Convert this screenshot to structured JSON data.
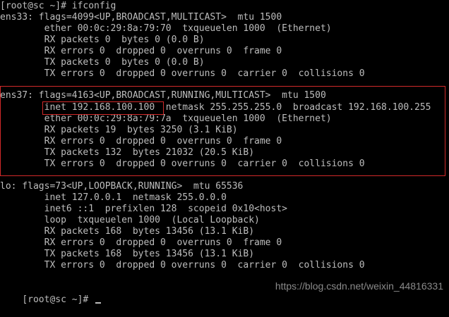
{
  "terminal": {
    "lines": [
      "[root@sc ~]# ifconfig",
      "ens33: flags=4099<UP,BROADCAST,MULTICAST>  mtu 1500",
      "        ether 00:0c:29:8a:79:70  txqueuelen 1000  (Ethernet)",
      "        RX packets 0  bytes 0 (0.0 B)",
      "        RX errors 0  dropped 0  overruns 0  frame 0",
      "        TX packets 0  bytes 0 (0.0 B)",
      "        TX errors 0  dropped 0 overruns 0  carrier 0  collisions 0",
      "",
      "ens37: flags=4163<UP,BROADCAST,RUNNING,MULTICAST>  mtu 1500",
      "        inet 192.168.100.100  netmask 255.255.255.0  broadcast 192.168.100.255",
      "        ether 00:0c:29:8a:79:7a  txqueuelen 1000  (Ethernet)",
      "        RX packets 19  bytes 3250 (3.1 KiB)",
      "        RX errors 0  dropped 0  overruns 0  frame 0",
      "        TX packets 132  bytes 21032 (20.5 KiB)",
      "        TX errors 0  dropped 0 overruns 0  carrier 0  collisions 0",
      "",
      "lo: flags=73<UP,LOOPBACK,RUNNING>  mtu 65536",
      "        inet 127.0.0.1  netmask 255.0.0.0",
      "        inet6 ::1  prefixlen 128  scopeid 0x10<host>",
      "        loop  txqueuelen 1000  (Local Loopback)",
      "        RX packets 168  bytes 13456 (13.1 KiB)",
      "        RX errors 0  dropped 0  overruns 0  frame 0",
      "        TX packets 168  bytes 13456 (13.1 KiB)",
      "        TX errors 0  dropped 0 overruns 0  carrier 0  collisions 0",
      "",
      "[root@sc ~]# "
    ]
  },
  "watermark": {
    "text": "https://blog.csdn.net/weixin_44816331"
  },
  "colors": {
    "background": "#000000",
    "text": "#bdbdbd",
    "highlight_box": "#d22a2a"
  }
}
